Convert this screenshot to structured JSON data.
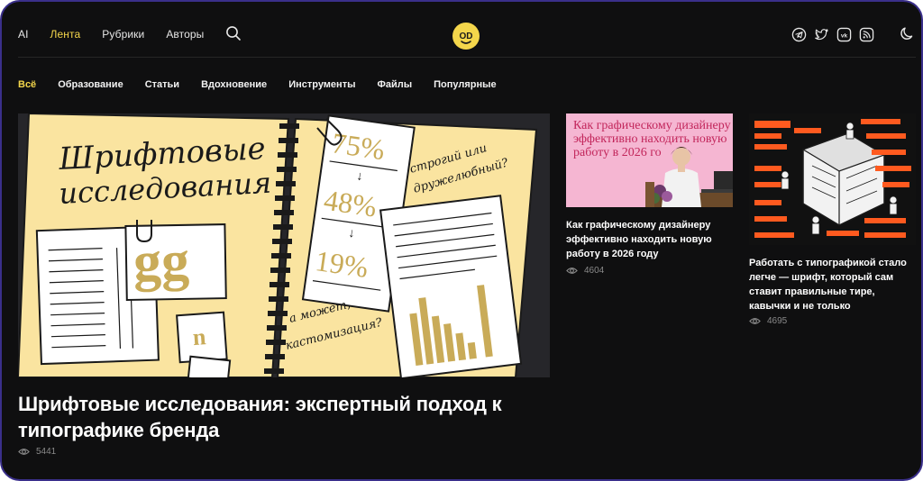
{
  "header": {
    "nav": [
      "AI",
      "Лента",
      "Рубрики",
      "Авторы"
    ],
    "active_nav": "Лента",
    "logo_text": "OD",
    "socials": [
      "telegram-icon",
      "twitter-icon",
      "vk-icon",
      "rss-icon"
    ],
    "theme_toggle": "moon-icon"
  },
  "categories": [
    "Всё",
    "Образование",
    "Статьи",
    "Вдохновение",
    "Инструменты",
    "Файлы",
    "Популярные"
  ],
  "hero": {
    "title": "Шрифтовые исследования: экспертный подход к типографике бренда",
    "views": "5441",
    "image": {
      "heading_line1": "Шрифтовые",
      "heading_line2": "исследования",
      "glyphs": "gg",
      "glyph_small": "n",
      "pct1": "75%",
      "pct2": "48%",
      "pct3": "19%",
      "arrow": "↓",
      "question1": "строгий или",
      "question2": "дружелюбный?",
      "question3": "а может,",
      "question4": "кастомизация?"
    }
  },
  "cards": [
    {
      "title": "Как графическому дизайнеру эффективно находить новую работу в 2026 году",
      "views": "4604",
      "image_text": "Как графическому дизайнеру эффективно находить новую работу в 2026 го"
    },
    {
      "title": "Работать с типографикой стало легче — шрифт, который сам ставит правильные тире, кавычки и не только",
      "views": "4695"
    }
  ],
  "colors": {
    "accent": "#f4d64b",
    "background": "#0f0f10",
    "pink": "#f5b6d2",
    "orange": "#ff5a1f",
    "paper": "#fae4a0"
  }
}
